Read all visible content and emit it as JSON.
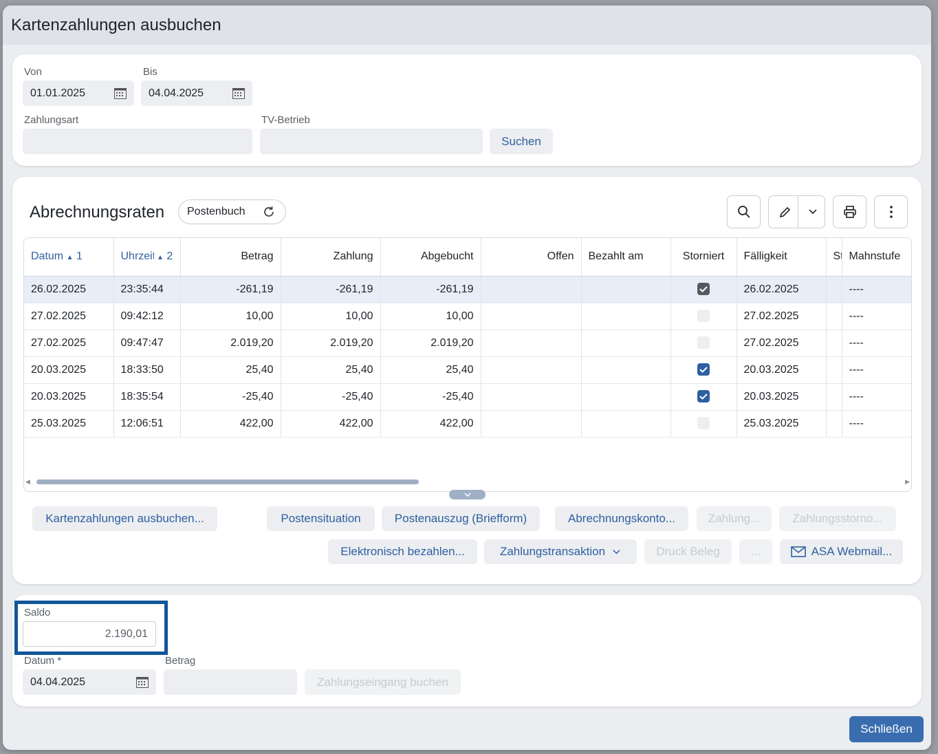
{
  "dialog": {
    "title": "Kartenzahlungen ausbuchen"
  },
  "search": {
    "von_label": "Von",
    "von_value": "01.01.2025",
    "bis_label": "Bis",
    "bis_value": "04.04.2025",
    "zahlungsart_label": "Zahlungsart",
    "zahlungsart_value": "",
    "tvbetrieb_label": "TV-Betrieb",
    "tvbetrieb_value": "",
    "search_button": "Suchen"
  },
  "rates": {
    "title": "Abrechnungsraten",
    "view_pill": "Postenbuch",
    "toolbar_icons": [
      "search-icon",
      "pencil-icon",
      "chevron-down-icon",
      "printer-icon",
      "more-vertical-icon"
    ],
    "columns": {
      "datum": "Datum",
      "datum_sort": "1",
      "uhrzeit": "Uhrzeit",
      "uhrzeit_sort": "2",
      "betrag": "Betrag",
      "zahlung": "Zahlung",
      "abgebucht": "Abgebucht",
      "offen": "Offen",
      "bezahlt_am": "Bezahlt am",
      "storniert": "Storniert",
      "faelligkeit": "Fälligkeit",
      "st": "St",
      "mahnstufe": "Mahnstufe"
    },
    "rows": [
      {
        "datum": "26.02.2025",
        "uhrzeit": "23:35:44",
        "betrag": "-261,19",
        "zahlung": "-261,19",
        "abgebucht": "-261,19",
        "offen": "",
        "bezahlt_am": "",
        "storniert": true,
        "faelligkeit": "26.02.2025",
        "st": "",
        "mahnstufe": "----"
      },
      {
        "datum": "27.02.2025",
        "uhrzeit": "09:42:12",
        "betrag": "10,00",
        "zahlung": "10,00",
        "abgebucht": "10,00",
        "offen": "",
        "bezahlt_am": "",
        "storniert": false,
        "faelligkeit": "27.02.2025",
        "st": "",
        "mahnstufe": "----"
      },
      {
        "datum": "27.02.2025",
        "uhrzeit": "09:47:47",
        "betrag": "2.019,20",
        "zahlung": "2.019,20",
        "abgebucht": "2.019,20",
        "offen": "",
        "bezahlt_am": "",
        "storniert": false,
        "faelligkeit": "27.02.2025",
        "st": "",
        "mahnstufe": "----"
      },
      {
        "datum": "20.03.2025",
        "uhrzeit": "18:33:50",
        "betrag": "25,40",
        "zahlung": "25,40",
        "abgebucht": "25,40",
        "offen": "",
        "bezahlt_am": "",
        "storniert": true,
        "faelligkeit": "20.03.2025",
        "st": "",
        "mahnstufe": "----"
      },
      {
        "datum": "20.03.2025",
        "uhrzeit": "18:35:54",
        "betrag": "-25,40",
        "zahlung": "-25,40",
        "abgebucht": "-25,40",
        "offen": "",
        "bezahlt_am": "",
        "storniert": true,
        "faelligkeit": "20.03.2025",
        "st": "",
        "mahnstufe": "----"
      },
      {
        "datum": "25.03.2025",
        "uhrzeit": "12:06:51",
        "betrag": "422,00",
        "zahlung": "422,00",
        "abgebucht": "422,00",
        "offen": "",
        "bezahlt_am": "",
        "storniert": false,
        "faelligkeit": "25.03.2025",
        "st": "",
        "mahnstufe": "----"
      }
    ],
    "actions": {
      "kartenzahlungen": "Kartenzahlungen ausbuchen...",
      "postensituation": "Postensituation",
      "postenauszug": "Postenauszug (Briefform)",
      "abrechnungskonto": "Abrechnungskonto...",
      "zahlung": "Zahlung...",
      "zahlungsstorno": "Zahlungsstorno...",
      "elektronisch": "Elektronisch bezahlen...",
      "zahlungstransaktion": "Zahlungstransaktion",
      "druck_beleg": "Druck Beleg",
      "ellipsis": "...",
      "webmail": "ASA Webmail..."
    }
  },
  "payment": {
    "saldo_label": "Saldo",
    "saldo_value": "2.190,01",
    "datum_label": "Datum",
    "datum_required": "*",
    "datum_value": "04.04.2025",
    "betrag_label": "Betrag",
    "betrag_value": "",
    "book_button": "Zahlungseingang buchen"
  },
  "footer": {
    "close_button": "Schließen"
  },
  "colors": {
    "accent": "#2e5fa0",
    "primary_button": "#3a6db0",
    "highlight_box": "#11569a"
  }
}
